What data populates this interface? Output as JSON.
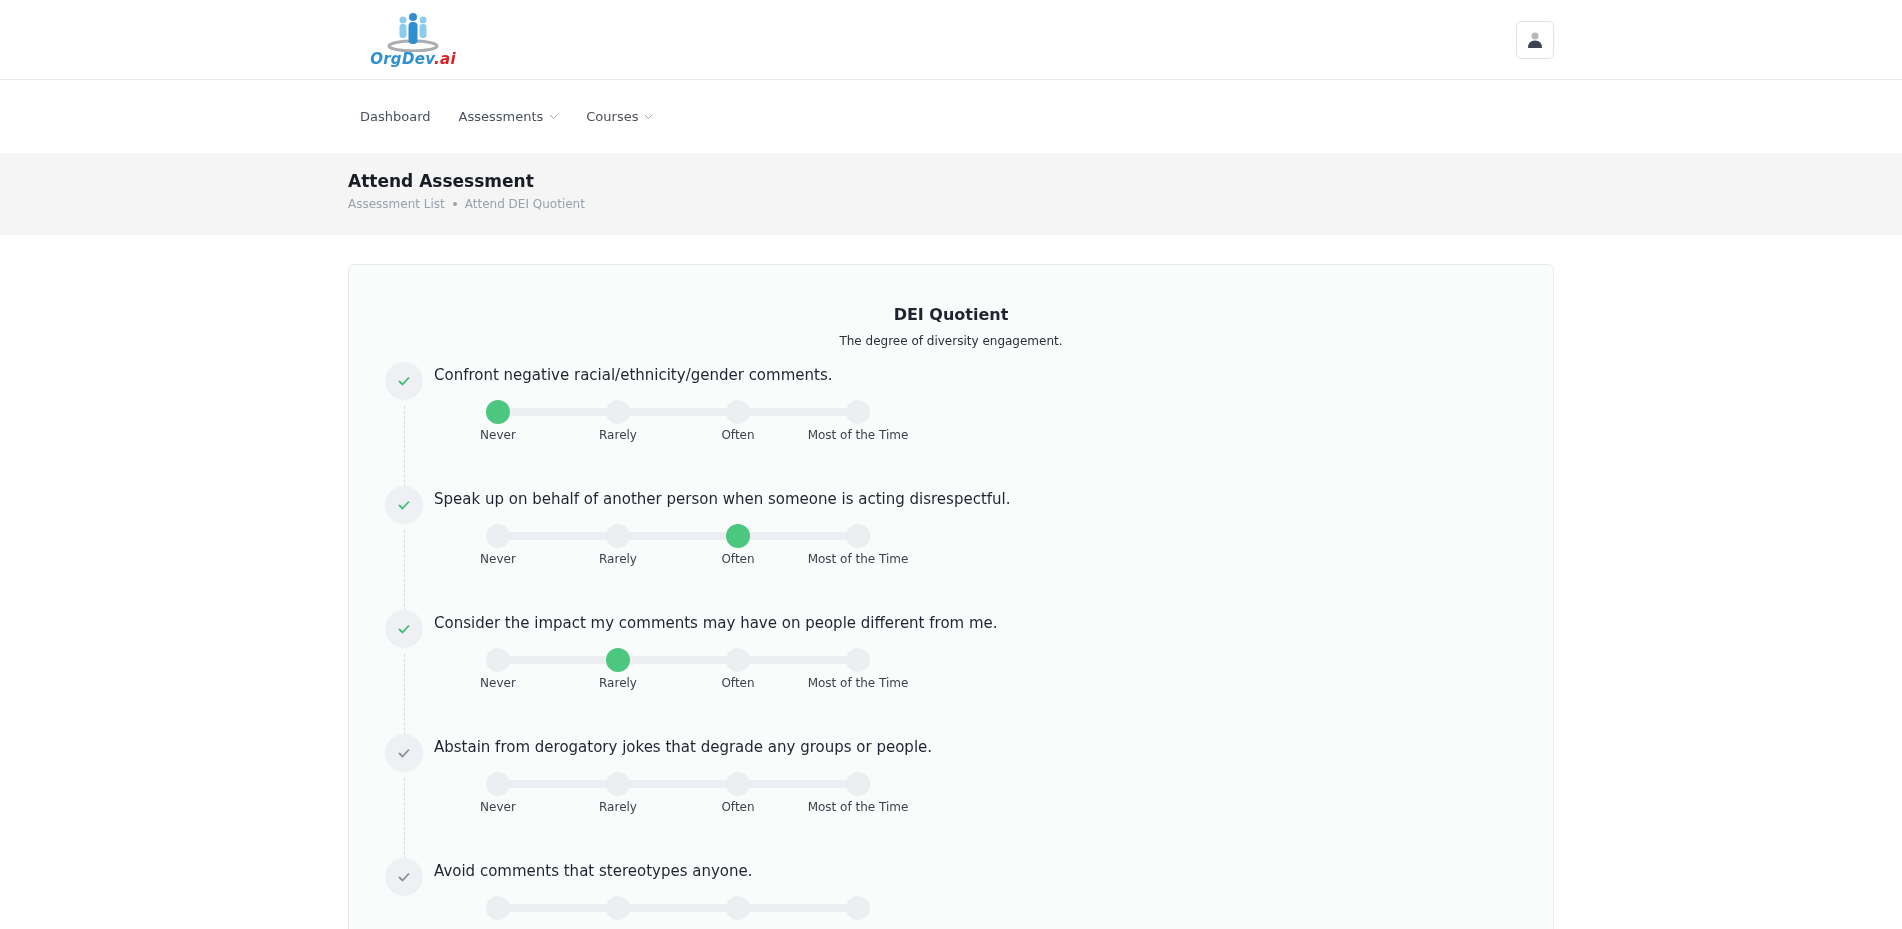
{
  "logo": {
    "name": "OrgDev",
    "domain": ".ai"
  },
  "nav": [
    {
      "label": "Dashboard",
      "has_dropdown": false
    },
    {
      "label": "Assessments",
      "has_dropdown": true
    },
    {
      "label": "Courses",
      "has_dropdown": true
    }
  ],
  "page_title": "Attend Assessment",
  "breadcrumb": [
    "Assessment List",
    "Attend DEI Quotient"
  ],
  "assessment": {
    "title": "DEI Quotient",
    "subtitle": "The degree of diversity engagement.",
    "questions": [
      {
        "text": "Confront negative racial/ethnicity/gender comments.",
        "answered": true,
        "options": [
          {
            "label": "Never",
            "selected": true
          },
          {
            "label": "Rarely",
            "selected": false
          },
          {
            "label": "Often",
            "selected": false
          },
          {
            "label": "Most of the Time",
            "selected": false
          }
        ]
      },
      {
        "text": "Speak up on behalf of another person when someone is acting disrespectful.",
        "answered": true,
        "options": [
          {
            "label": "Never",
            "selected": false
          },
          {
            "label": "Rarely",
            "selected": false
          },
          {
            "label": "Often",
            "selected": true
          },
          {
            "label": "Most of the Time",
            "selected": false
          }
        ]
      },
      {
        "text": "Consider the impact my comments may have on people different from me.",
        "answered": true,
        "options": [
          {
            "label": "Never",
            "selected": false
          },
          {
            "label": "Rarely",
            "selected": true
          },
          {
            "label": "Often",
            "selected": false
          },
          {
            "label": "Most of the Time",
            "selected": false
          }
        ]
      },
      {
        "text": "Abstain from derogatory jokes that degrade any groups or people.",
        "answered": false,
        "options": [
          {
            "label": "Never",
            "selected": false
          },
          {
            "label": "Rarely",
            "selected": false
          },
          {
            "label": "Often",
            "selected": false
          },
          {
            "label": "Most of the Time",
            "selected": false
          }
        ]
      },
      {
        "text": "Avoid comments that stereotypes anyone.",
        "answered": false,
        "options": [
          {
            "selected": false
          },
          {
            "selected": false
          },
          {
            "selected": false
          },
          {
            "selected": false
          }
        ]
      }
    ]
  }
}
